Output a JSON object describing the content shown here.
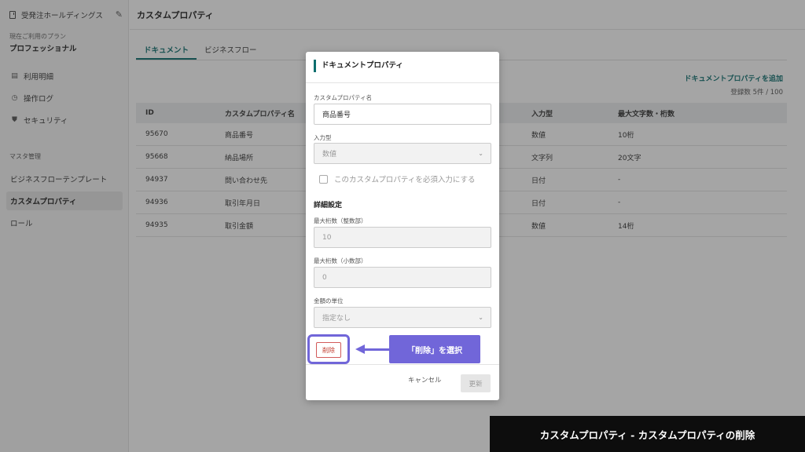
{
  "sidebar": {
    "company": "受発注ホールディングス",
    "plan_label": "現在ご利用のプラン",
    "plan_name": "プロフェッショナル",
    "items": [
      {
        "label": "利用明細",
        "icon": "receipt-icon"
      },
      {
        "label": "操作ログ",
        "icon": "history-icon"
      },
      {
        "label": "セキュリティ",
        "icon": "shield-icon"
      }
    ],
    "section_label": "マスタ管理",
    "master_items": [
      {
        "label": "ビジネスフローテンプレート"
      },
      {
        "label": "カスタムプロパティ"
      },
      {
        "label": "ロール"
      }
    ]
  },
  "main": {
    "title": "カスタムプロパティ",
    "tabs": [
      {
        "label": "ドキュメント"
      },
      {
        "label": "ビジネスフロー"
      }
    ],
    "add_link": "ドキュメントプロパティを追加",
    "count": "登録数 5件 / 100",
    "table": {
      "headers": [
        "ID",
        "カスタムプロパティ名",
        "入力型",
        "最大文字数・桁数"
      ],
      "rows": [
        [
          "95670",
          "商品番号",
          "数値",
          "10桁"
        ],
        [
          "95668",
          "納品場所",
          "文字列",
          "20文字"
        ],
        [
          "94937",
          "問い合わせ先",
          "日付",
          "-"
        ],
        [
          "94936",
          "取引年月日",
          "日付",
          "-"
        ],
        [
          "94935",
          "取引金額",
          "数値",
          "14桁"
        ]
      ]
    }
  },
  "modal": {
    "title": "ドキュメントプロパティ",
    "name_label": "カスタムプロパティ名",
    "name_value": "商品番号",
    "type_label": "入力型",
    "type_value": "数値",
    "required_label": "このカスタムプロパティを必須入力にする",
    "detail_title": "詳細設定",
    "int_label": "最大桁数（整数部）",
    "int_value": "10",
    "dec_label": "最大桁数（小数部）",
    "dec_value": "0",
    "unit_label": "金額の単位",
    "unit_value": "指定なし",
    "delete_label": "削除",
    "cancel_label": "キャンセル",
    "update_label": "更新"
  },
  "annotation": {
    "callout": "「削除」を選択",
    "caption": "カスタムプロパティ - カスタムプロパティの削除",
    "accent_color": "#7166d9"
  },
  "colors": {
    "brand": "#0d6e6e",
    "danger": "#c0392b"
  }
}
